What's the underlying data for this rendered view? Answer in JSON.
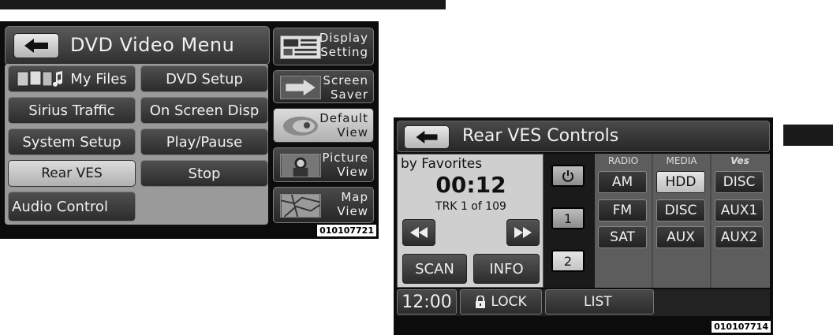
{
  "screen1": {
    "title": "DVD Video Menu",
    "menu": {
      "my_files": "My Files",
      "dvd_setup": "DVD Setup",
      "sirius_traffic": "Sirius Traffic",
      "on_screen_disp": "On Screen Disp",
      "system_setup": "System Setup",
      "play_pause": "Play/Pause",
      "rear_ves": "Rear VES",
      "stop": "Stop",
      "audio_control": "Audio Control"
    },
    "side": {
      "display_setting": [
        "Display",
        "Setting"
      ],
      "screen_saver": [
        "Screen",
        "Saver"
      ],
      "default_view": [
        "Default",
        "View"
      ],
      "picture_view": [
        "Picture",
        "View"
      ],
      "map_view": [
        "Map",
        "View"
      ]
    },
    "code": "010107721"
  },
  "screen2": {
    "title": "Rear VES Controls",
    "mode": "by Favorites",
    "time": "00:12",
    "track": "TRK 1 of 109",
    "scan": "SCAN",
    "info": "INFO",
    "screen_buttons": [
      "1",
      "2"
    ],
    "columns": {
      "radio": {
        "header": "RADIO",
        "items": [
          "AM",
          "FM",
          "SAT"
        ]
      },
      "media": {
        "header": "MEDIA",
        "items": [
          "HDD",
          "DISC",
          "AUX"
        ]
      },
      "ves": {
        "header": "Ves",
        "items": [
          "DISC",
          "AUX1",
          "AUX2"
        ]
      }
    },
    "clock": "12:00",
    "lock": "LOCK",
    "list": "LIST",
    "code": "010107714"
  }
}
